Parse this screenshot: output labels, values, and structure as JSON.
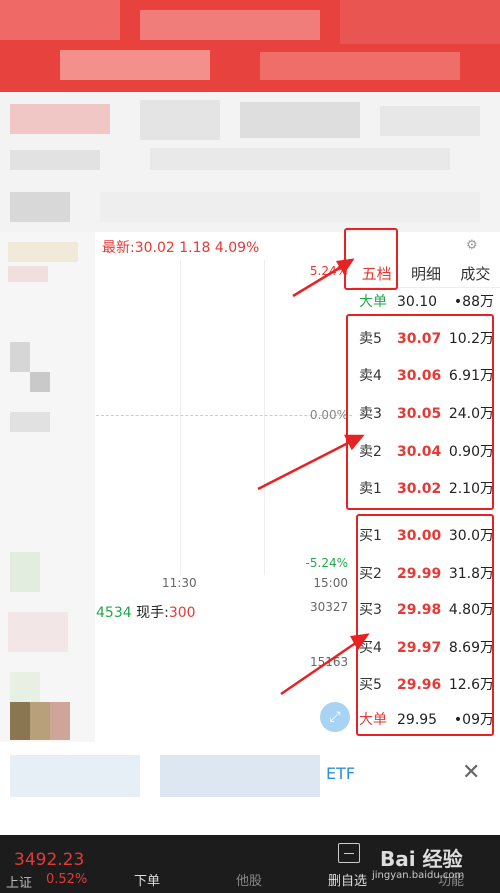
{
  "quote": {
    "latest_label": "最新:30.02 1.18 4.09%",
    "gear_icon": "gear-icon"
  },
  "chart": {
    "pct_top": "5.24%",
    "pct_mid": "0.00%",
    "pct_bot": "-5.24%",
    "time_mid": "11:30",
    "time_end": "15:00",
    "vol_code": "4534",
    "vol_now_label": " 现手:",
    "vol_now_value": "300",
    "vol_val1": "30327",
    "vol_val2": "15163"
  },
  "tabs": [
    {
      "label": "五档",
      "active": true
    },
    {
      "label": "明细",
      "active": false
    },
    {
      "label": "成交",
      "active": false
    }
  ],
  "big_order_top": {
    "label": "大单",
    "price": "30.10",
    "volume": "•88万"
  },
  "sell_orders": [
    {
      "label": "卖5",
      "price": "30.07",
      "volume": "10.2万"
    },
    {
      "label": "卖4",
      "price": "30.06",
      "volume": "6.91万"
    },
    {
      "label": "卖3",
      "price": "30.05",
      "volume": "24.0万"
    },
    {
      "label": "卖2",
      "price": "30.04",
      "volume": "0.90万"
    },
    {
      "label": "卖1",
      "price": "30.02",
      "volume": "2.10万"
    }
  ],
  "buy_orders": [
    {
      "label": "买1",
      "price": "30.00",
      "volume": "30.0万"
    },
    {
      "label": "买2",
      "price": "29.99",
      "volume": "31.8万"
    },
    {
      "label": "买3",
      "price": "29.98",
      "volume": "4.80万"
    },
    {
      "label": "买4",
      "price": "29.97",
      "volume": "8.69万"
    },
    {
      "label": "买5",
      "price": "29.96",
      "volume": "12.6万"
    }
  ],
  "big_order_bottom": {
    "label": "大单",
    "price": "29.95",
    "volume": "•09万"
  },
  "search": {
    "etf_text": "ETF",
    "close": "✕"
  },
  "bottom": {
    "index_value": "3492.23",
    "index_name": "上证",
    "index_pct": "0.52%",
    "order": "下单",
    "trade": "他股",
    "remove_watch": "删自选",
    "more": "功能",
    "watermark": "Bai 经验",
    "watermark_sub": "jingyan.baidu.com"
  },
  "colors": {
    "up": "#e53935",
    "down": "#22a84a",
    "highlight": "#e82222"
  }
}
